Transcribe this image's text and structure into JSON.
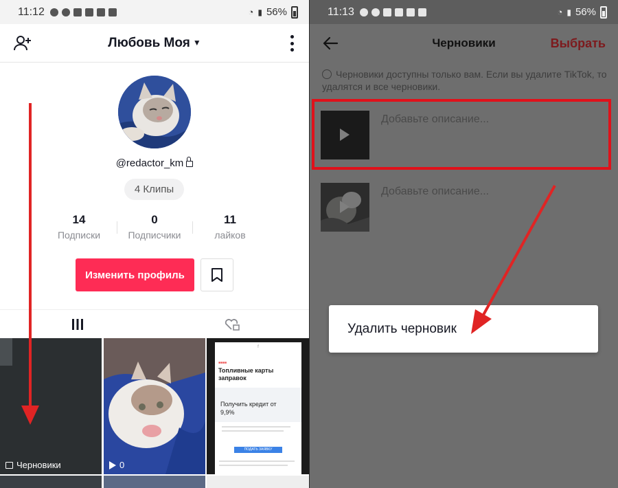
{
  "left": {
    "status": {
      "time": "11:12",
      "battery": "56%"
    },
    "header": {
      "username": "Любовь Моя"
    },
    "profile": {
      "handle": "@redactor_km",
      "clips": "4 Клипы",
      "stats": [
        {
          "num": "14",
          "label": "Подписки"
        },
        {
          "num": "0",
          "label": "Подписчики"
        },
        {
          "num": "11",
          "label": "лайков"
        }
      ],
      "edit_label": "Изменить профиль"
    },
    "grid": {
      "drafts_label": "Черновики",
      "views": "0",
      "ad": {
        "title": "Топливные карты заправок",
        "credit": "Получить кредит от 9,9%",
        "button": "ПОДАТЬ ЗАЯВКУ"
      }
    }
  },
  "right": {
    "status": {
      "time": "11:13",
      "battery": "56%"
    },
    "header": {
      "title": "Черновики",
      "select": "Выбрать"
    },
    "notice": "Черновики доступны только вам. Если вы удалите TikTok, то удалятся и все черновики.",
    "drafts": [
      {
        "desc": "Добавьте описание..."
      },
      {
        "desc": "Добавьте описание..."
      }
    ],
    "menu": {
      "delete": "Удалить черновик"
    }
  },
  "colors": {
    "accent": "#fe2c55",
    "annotation": "#e02424",
    "select": "#7d1a1d"
  }
}
